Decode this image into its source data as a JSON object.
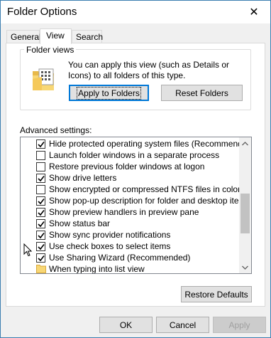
{
  "window": {
    "title": "Folder Options",
    "close_glyph": "✕"
  },
  "tabs": [
    {
      "label": "General",
      "active": false
    },
    {
      "label": "View",
      "active": true
    },
    {
      "label": "Search",
      "active": false
    }
  ],
  "folder_views": {
    "group_label": "Folder views",
    "description": "You can apply this view (such as Details or Icons) to all folders of this type.",
    "apply_button": "Apply to Folders",
    "reset_button": "Reset Folders"
  },
  "advanced": {
    "label": "Advanced settings:",
    "items": [
      {
        "label": "Hide protected operating system files (Recommended)",
        "type": "checkbox",
        "checked": true
      },
      {
        "label": "Launch folder windows in a separate process",
        "type": "checkbox",
        "checked": false
      },
      {
        "label": "Restore previous folder windows at logon",
        "type": "checkbox",
        "checked": false
      },
      {
        "label": "Show drive letters",
        "type": "checkbox",
        "checked": true
      },
      {
        "label": "Show encrypted or compressed NTFS files in color",
        "type": "checkbox",
        "checked": false
      },
      {
        "label": "Show pop-up description for folder and desktop items",
        "type": "checkbox",
        "checked": true
      },
      {
        "label": "Show preview handlers in preview pane",
        "type": "checkbox",
        "checked": true
      },
      {
        "label": "Show status bar",
        "type": "checkbox",
        "checked": true
      },
      {
        "label": "Show sync provider notifications",
        "type": "checkbox",
        "checked": true
      },
      {
        "label": "Use check boxes to select items",
        "type": "checkbox",
        "checked": true
      },
      {
        "label": "Use Sharing Wizard (Recommended)",
        "type": "checkbox",
        "checked": true
      },
      {
        "label": "When typing into list view",
        "type": "folder",
        "checked": false
      }
    ],
    "restore_defaults": "Restore Defaults"
  },
  "footer": {
    "ok": "OK",
    "cancel": "Cancel",
    "apply": "Apply"
  },
  "colors": {
    "accent": "#0078d7",
    "window_border": "#3c7fb1",
    "check": "#000000"
  }
}
